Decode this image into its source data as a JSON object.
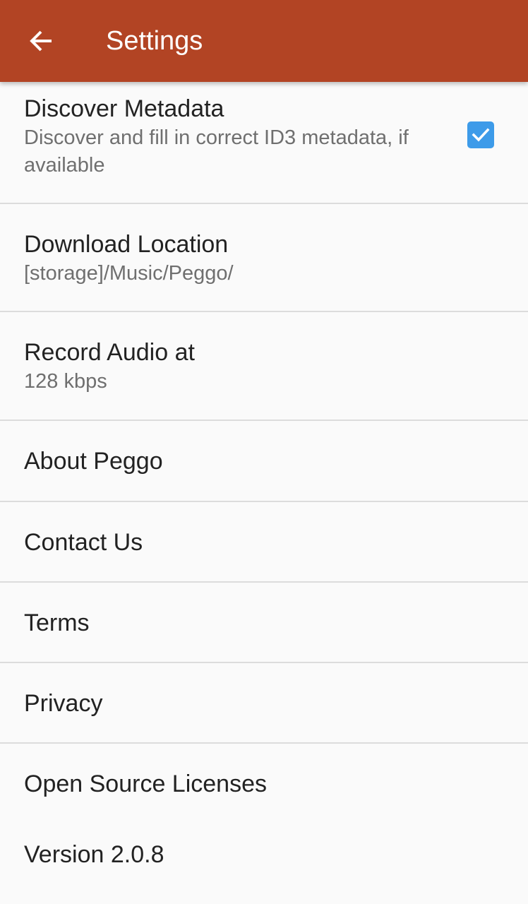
{
  "app_bar": {
    "title": "Settings",
    "back_icon": "arrow-left-icon"
  },
  "colors": {
    "app_bar": "#b24424",
    "background": "#fafafa",
    "checkbox": "#3d9be9",
    "divider": "#dcdcdc"
  },
  "settings": {
    "discover_metadata": {
      "title": "Discover Metadata",
      "subtitle": "Discover and fill in correct ID3 metadata, if available",
      "checked": true
    },
    "download_location": {
      "title": "Download Location",
      "subtitle": "[storage]/Music/Peggo/"
    },
    "record_audio": {
      "title": "Record Audio at",
      "subtitle": "128 kbps"
    },
    "about": {
      "title": "About Peggo"
    },
    "contact": {
      "title": "Contact Us"
    },
    "terms": {
      "title": "Terms"
    },
    "privacy": {
      "title": "Privacy"
    },
    "licenses": {
      "title": "Open Source Licenses"
    },
    "version": {
      "title": "Version 2.0.8"
    }
  }
}
